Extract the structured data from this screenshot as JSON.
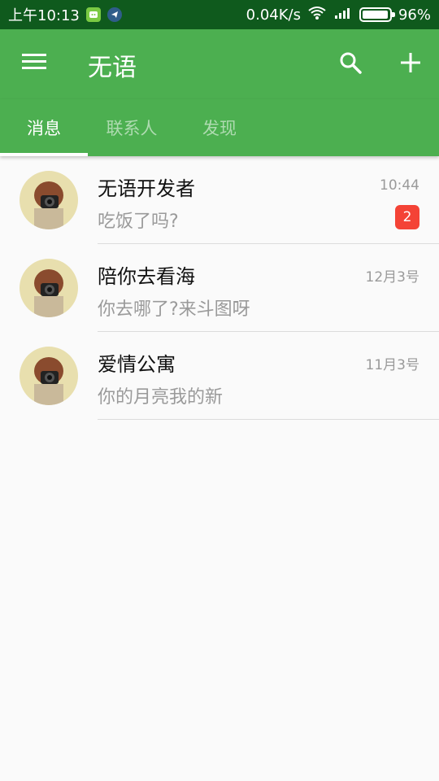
{
  "status_bar": {
    "time": "上午10:13",
    "speed": "0.04K/s",
    "battery": "96%",
    "battery_level": 0.96,
    "icons": [
      "app-notify-icon",
      "telegram-icon",
      "wifi-icon",
      "signal-icon",
      "battery-icon"
    ]
  },
  "toolbar": {
    "title": "无语",
    "menu_icon": "menu-icon",
    "search_icon": "search-icon",
    "add_icon": "plus-icon"
  },
  "tabs": [
    {
      "label": "消息",
      "active": true
    },
    {
      "label": "联系人",
      "active": false
    },
    {
      "label": "发现",
      "active": false
    }
  ],
  "conversations": [
    {
      "name": "无语开发者",
      "preview": "吃饭了吗?",
      "time": "10:44",
      "badge": "2"
    },
    {
      "name": "陪你去看海",
      "preview": "你去哪了?来斗图呀",
      "time": "12月3号"
    },
    {
      "name": "爱情公寓",
      "preview": "你的月亮我的新",
      "time": "11月3号"
    }
  ],
  "colors": {
    "primary": "#4caf50",
    "status_bar": "#0f5a1d",
    "badge": "#f44336",
    "background": "#fafafa"
  }
}
